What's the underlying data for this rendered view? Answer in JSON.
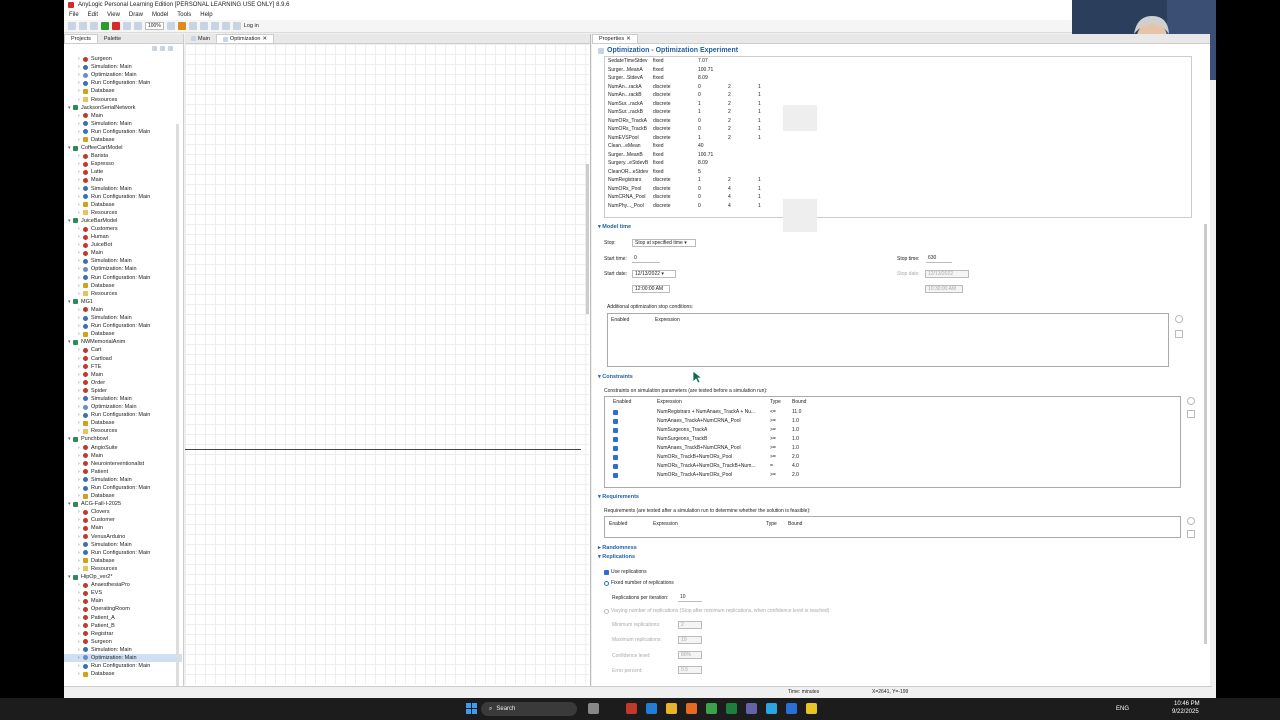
{
  "app": {
    "title": "AnyLogic Personal Learning Edition [PERSONAL LEARNING USE ONLY] 8.9.6"
  },
  "menu": [
    "File",
    "Edit",
    "View",
    "Draw",
    "Model",
    "Tools",
    "Help"
  ],
  "toolbar": {
    "zoom": "100%",
    "login": "Log in"
  },
  "left_tabs": [
    "Projects",
    "Palette"
  ],
  "tree": [
    {
      "d": 1,
      "t": "Surgeon",
      "i": "red"
    },
    {
      "d": 1,
      "t": "Simulation: Main",
      "i": "blue"
    },
    {
      "d": 1,
      "t": "Optimization: Main",
      "i": "opt"
    },
    {
      "d": 1,
      "t": "Run Configuration: Main",
      "i": "blue"
    },
    {
      "d": 1,
      "t": "Database",
      "i": "db"
    },
    {
      "d": 1,
      "t": "Resources",
      "i": "fold"
    },
    {
      "d": 0,
      "t": "JacksonSerialNetwork",
      "i": "proj"
    },
    {
      "d": 1,
      "t": "Main",
      "i": "red"
    },
    {
      "d": 1,
      "t": "Simulation: Main",
      "i": "blue"
    },
    {
      "d": 1,
      "t": "Run Configuration: Main",
      "i": "blue"
    },
    {
      "d": 1,
      "t": "Database",
      "i": "db"
    },
    {
      "d": 0,
      "t": "CoffeeCartModel",
      "i": "proj"
    },
    {
      "d": 1,
      "t": "Barista",
      "i": "red"
    },
    {
      "d": 1,
      "t": "Espresso",
      "i": "red"
    },
    {
      "d": 1,
      "t": "Latte",
      "i": "red"
    },
    {
      "d": 1,
      "t": "Main",
      "i": "red"
    },
    {
      "d": 1,
      "t": "Simulation: Main",
      "i": "blue"
    },
    {
      "d": 1,
      "t": "Run Configuration: Main",
      "i": "blue"
    },
    {
      "d": 1,
      "t": "Database",
      "i": "db"
    },
    {
      "d": 1,
      "t": "Resources",
      "i": "fold"
    },
    {
      "d": 0,
      "t": "JuiceBarModel",
      "i": "proj"
    },
    {
      "d": 1,
      "t": "Customers",
      "i": "red"
    },
    {
      "d": 1,
      "t": "Human",
      "i": "red"
    },
    {
      "d": 1,
      "t": "JuiceBot",
      "i": "red"
    },
    {
      "d": 1,
      "t": "Main",
      "i": "red"
    },
    {
      "d": 1,
      "t": "Simulation: Main",
      "i": "blue"
    },
    {
      "d": 1,
      "t": "Optimization: Main",
      "i": "opt"
    },
    {
      "d": 1,
      "t": "Run Configuration: Main",
      "i": "blue"
    },
    {
      "d": 1,
      "t": "Database",
      "i": "db"
    },
    {
      "d": 1,
      "t": "Resources",
      "i": "fold"
    },
    {
      "d": 0,
      "t": "MG1",
      "i": "proj"
    },
    {
      "d": 1,
      "t": "Main",
      "i": "red"
    },
    {
      "d": 1,
      "t": "Simulation: Main",
      "i": "blue"
    },
    {
      "d": 1,
      "t": "Run Configuration: Main",
      "i": "blue"
    },
    {
      "d": 1,
      "t": "Database",
      "i": "db"
    },
    {
      "d": 0,
      "t": "NWMemorialAnim",
      "i": "proj"
    },
    {
      "d": 1,
      "t": "Cart",
      "i": "red"
    },
    {
      "d": 1,
      "t": "Cartload",
      "i": "red"
    },
    {
      "d": 1,
      "t": "FTE",
      "i": "red"
    },
    {
      "d": 1,
      "t": "Main",
      "i": "red"
    },
    {
      "d": 1,
      "t": "Order",
      "i": "red"
    },
    {
      "d": 1,
      "t": "Spider",
      "i": "red"
    },
    {
      "d": 1,
      "t": "Simulation: Main",
      "i": "blue"
    },
    {
      "d": 1,
      "t": "Optimization: Main",
      "i": "opt"
    },
    {
      "d": 1,
      "t": "Run Configuration: Main",
      "i": "blue"
    },
    {
      "d": 1,
      "t": "Database",
      "i": "db"
    },
    {
      "d": 1,
      "t": "Resources",
      "i": "fold"
    },
    {
      "d": 0,
      "t": "Punchbowl",
      "i": "proj"
    },
    {
      "d": 1,
      "t": "AngioSuite",
      "i": "red"
    },
    {
      "d": 1,
      "t": "Main",
      "i": "red"
    },
    {
      "d": 1,
      "t": "Neurointerventionalist",
      "i": "red"
    },
    {
      "d": 1,
      "t": "Patient",
      "i": "red"
    },
    {
      "d": 1,
      "t": "Simulation: Main",
      "i": "blue"
    },
    {
      "d": 1,
      "t": "Run Configuration: Main",
      "i": "blue"
    },
    {
      "d": 1,
      "t": "Database",
      "i": "db"
    },
    {
      "d": 0,
      "t": "ACG-Fall-I-2025",
      "i": "proj"
    },
    {
      "d": 1,
      "t": "Clovers",
      "i": "red"
    },
    {
      "d": 1,
      "t": "Customer",
      "i": "red"
    },
    {
      "d": 1,
      "t": "Main",
      "i": "red"
    },
    {
      "d": 1,
      "t": "VenusArduino",
      "i": "red"
    },
    {
      "d": 1,
      "t": "Simulation: Main",
      "i": "blue"
    },
    {
      "d": 1,
      "t": "Run Configuration: Main",
      "i": "blue"
    },
    {
      "d": 1,
      "t": "Database",
      "i": "db"
    },
    {
      "d": 1,
      "t": "Resources",
      "i": "fold"
    },
    {
      "d": 0,
      "t": "HipOp_ver2*",
      "i": "proj"
    },
    {
      "d": 1,
      "t": "AnaesthesiaPro",
      "i": "red"
    },
    {
      "d": 1,
      "t": "EVS",
      "i": "red"
    },
    {
      "d": 1,
      "t": "Main",
      "i": "red"
    },
    {
      "d": 1,
      "t": "OperatingRoom",
      "i": "red"
    },
    {
      "d": 1,
      "t": "Patient_A",
      "i": "red"
    },
    {
      "d": 1,
      "t": "Patient_B",
      "i": "red"
    },
    {
      "d": 1,
      "t": "Registrar",
      "i": "red"
    },
    {
      "d": 1,
      "t": "Surgeon",
      "i": "red"
    },
    {
      "d": 1,
      "t": "Simulation: Main",
      "i": "blue"
    },
    {
      "d": 1,
      "t": "Optimization: Main",
      "i": "opt",
      "sel": true
    },
    {
      "d": 1,
      "t": "Run Configuration: Main",
      "i": "blue"
    },
    {
      "d": 1,
      "t": "Database",
      "i": "db"
    }
  ],
  "editor_tabs": [
    "Main",
    "Optimization"
  ],
  "props_tab": "Properties",
  "props_title": "Optimization - Optimization Experiment",
  "params": [
    [
      "SedateTimeStdev",
      "fixed",
      "7.07",
      "",
      ""
    ],
    [
      "Surger...MeanA",
      "fixed",
      "100.71",
      "",
      ""
    ],
    [
      "Surger...StdevA",
      "fixed",
      "8.09",
      "",
      ""
    ],
    [
      "NumAn...rackA",
      "discrete",
      "0",
      "2",
      "1"
    ],
    [
      "NumAn...rackB",
      "discrete",
      "0",
      "2",
      "1"
    ],
    [
      "NumSur...rackA",
      "discrete",
      "1",
      "2",
      "1"
    ],
    [
      "NumSur...rackB",
      "discrete",
      "1",
      "2",
      "1"
    ],
    [
      "NumORs_TrackA",
      "discrete",
      "0",
      "2",
      "1"
    ],
    [
      "NumORs_TrackB",
      "discrete",
      "0",
      "2",
      "1"
    ],
    [
      "NumEVSPool",
      "discrete",
      "1",
      "2",
      "1"
    ],
    [
      "Clean...eMean",
      "fixed",
      "40",
      "",
      ""
    ],
    [
      "Surger...MeanB",
      "fixed",
      "100.71",
      "",
      ""
    ],
    [
      "Surgery...eStdevB",
      "fixed",
      "8.09",
      "",
      ""
    ],
    [
      "CleanOR...eStdev",
      "fixed",
      "5",
      "",
      ""
    ],
    [
      "NumRegistrars",
      "discrete",
      "1",
      "2",
      "1"
    ],
    [
      "NumORs_Pool",
      "discrete",
      "0",
      "4",
      "1"
    ],
    [
      "NumCRNA_Pool",
      "discrete",
      "0",
      "4",
      "1"
    ],
    [
      "NumPhy..._Pool",
      "discrete",
      "0",
      "4",
      "1"
    ]
  ],
  "model_time": {
    "section": "Model time",
    "stop_label": "Stop:",
    "stop_value": "Stop at specified time",
    "start_time_label": "Start time:",
    "start_time": "0",
    "stop_time_label": "Stop time:",
    "stop_time": "630",
    "start_date_label": "Start date:",
    "start_date": "12/13/2022",
    "stop_date_label": "Stop date:",
    "stop_date": "12/13/2022",
    "start_clock": "12:00:00 AM",
    "stop_clock": "10:30:00 AM",
    "addl": "Additional optimization stop conditions:",
    "col_enabled": "Enabled",
    "col_expression": "Expression"
  },
  "constraints": {
    "section": "Constraints",
    "desc": "Constraints on simulation parameters (are tested before a simulation run):",
    "headers": [
      "Enabled",
      "Expression",
      "Type",
      "Bound"
    ],
    "rows": [
      [
        "NumRegistrars + NumAnaes_TrackA + Nu...",
        "<=",
        "11.0"
      ],
      [
        "NumAnaes_TrackA+NumCRNA_Pool",
        ">=",
        "1.0"
      ],
      [
        "NumSurgeons_TrackA",
        ">=",
        "1.0"
      ],
      [
        "NumSurgeons_TrackB",
        ">=",
        "1.0"
      ],
      [
        "NumAnaes_TrackB+NumCRNA_Pool",
        ">=",
        "1.0"
      ],
      [
        "NumORs_TrackB+NumORs_Pool",
        ">=",
        "2.0"
      ],
      [
        "NumORs_TrackA+NumORs_TrackB+Num...",
        "=",
        "4.0"
      ],
      [
        "NumORs_TrackA+NumORs_Pool",
        ">=",
        "2.0"
      ]
    ]
  },
  "requirements": {
    "section": "Requirements",
    "desc": "Requirements (are tested after a simulation run to determine whether the solution is feasible):",
    "headers": [
      "Enabled",
      "Expression",
      "Type",
      "Bound"
    ]
  },
  "randomness": {
    "section": "Randomness"
  },
  "replications": {
    "section": "Replications",
    "use": "Use replications",
    "fixed": "Fixed number of replications",
    "per_iter_label": "Replications per iteration:",
    "per_iter": "10",
    "varying": "Varying number of replications (Stop after minimum replications, when confidence level is reached)",
    "min_label": "Minimum replications:",
    "min": "2",
    "max_label": "Maximum replications:",
    "max": "10",
    "conf_label": "Confidence level:",
    "conf": "80%",
    "err_label": "Error percent:",
    "err": "0.5"
  },
  "status": {
    "time": "Time: minutes",
    "coords": "X=2641, Y=-199"
  },
  "taskbar": {
    "search": "Search",
    "lang": "ENG",
    "time": "10:46 PM",
    "date": "9/22/2025"
  }
}
